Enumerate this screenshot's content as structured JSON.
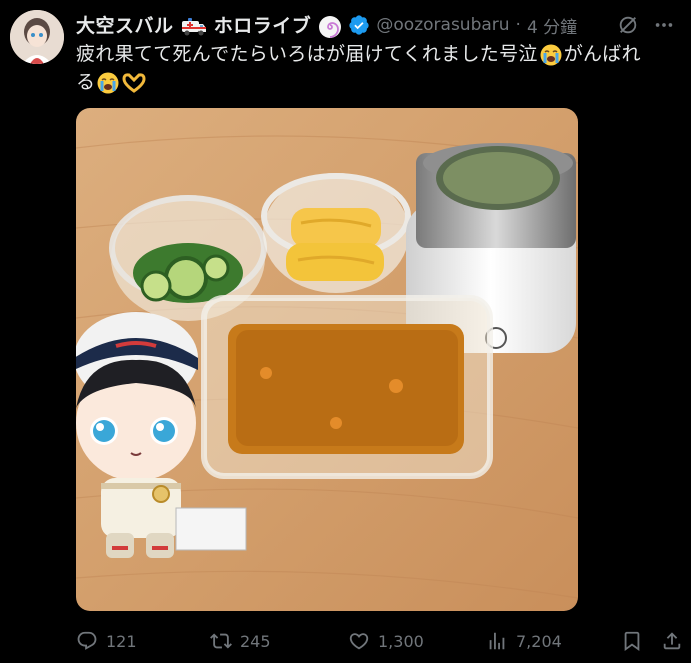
{
  "user": {
    "display_name_part1": "大空スバル",
    "display_name_part2": "ホロライブ",
    "handle": "@oozorasubaru",
    "separator": "·",
    "time": "4 分鐘"
  },
  "tweet": {
    "text_main": "疲れ果てて死んでたらいろはが届けてくれました号泣",
    "text_tail": "がんばれ",
    "text_line2": "る"
  },
  "stats": {
    "replies": "121",
    "retweets": "245",
    "likes": "1,300",
    "views": "7,204"
  },
  "colors": {
    "muted": "#71767b",
    "text": "#e7e9ea",
    "verified": "#1d9bf0",
    "background": "#000000"
  },
  "icons": [
    "ambulance-emoji",
    "swirl-emoji",
    "verified-icon",
    "grok-icon",
    "more-icon",
    "crying-emoji",
    "heart-hands-emoji",
    "reply-icon",
    "retweet-icon",
    "like-icon",
    "views-icon",
    "bookmark-icon",
    "share-icon"
  ]
}
